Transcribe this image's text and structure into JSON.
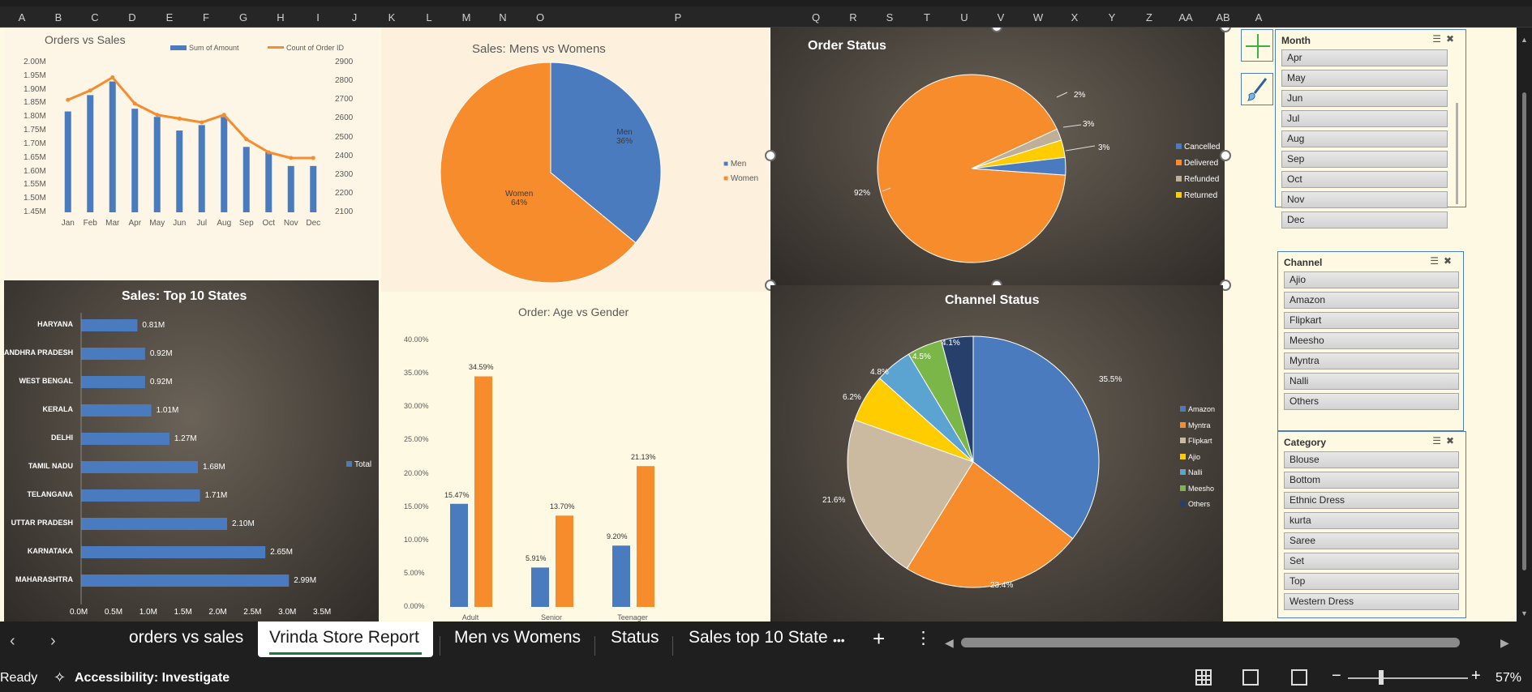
{
  "columns": [
    "A",
    "B",
    "C",
    "D",
    "E",
    "F",
    "G",
    "H",
    "I",
    "J",
    "K",
    "L",
    "M",
    "N",
    "O",
    "P",
    "Q",
    "R",
    "S",
    "T",
    "U",
    "V",
    "W",
    "X",
    "Y",
    "Z",
    "AA",
    "AB",
    "A"
  ],
  "chart_data": [
    {
      "type": "bar",
      "title": "Orders vs Sales",
      "categories": [
        "Jan",
        "Feb",
        "Mar",
        "Apr",
        "May",
        "Jun",
        "Jul",
        "Aug",
        "Sep",
        "Oct",
        "Nov",
        "Dec"
      ],
      "series": [
        {
          "name": "Sum of Amount",
          "type": "bar",
          "values": [
            1.82,
            1.88,
            1.93,
            1.83,
            1.8,
            1.75,
            1.77,
            1.8,
            1.69,
            1.67,
            1.62,
            1.62
          ]
        },
        {
          "name": "Count of Order ID",
          "type": "line",
          "axis": "secondary",
          "values": [
            2700,
            2750,
            2820,
            2680,
            2620,
            2600,
            2580,
            2620,
            2490,
            2420,
            2390,
            2390
          ]
        }
      ],
      "y_ticks": [
        "2.00M",
        "1.95M",
        "1.90M",
        "1.85M",
        "1.80M",
        "1.75M",
        "1.70M",
        "1.65M",
        "1.60M",
        "1.55M",
        "1.50M",
        "1.45M"
      ],
      "y2_ticks": [
        "2900",
        "2800",
        "2700",
        "2600",
        "2500",
        "2400",
        "2300",
        "2200",
        "2100"
      ],
      "ylim": [
        1.45,
        2.0
      ],
      "y2lim": [
        2100,
        2900
      ],
      "legend_position": "top"
    },
    {
      "type": "pie",
      "title": "Sales: Mens vs Womens",
      "slices": [
        {
          "label": "Men",
          "value": 36,
          "color": "#4a7bbf"
        },
        {
          "label": "Women",
          "value": 64,
          "color": "#f78c2d"
        }
      ],
      "labels": {
        "men": "Men",
        "men_pct": "36%",
        "women": "Women",
        "women_pct": "64%"
      },
      "legend_position": "right"
    },
    {
      "type": "pie",
      "title": "Order Status",
      "slices": [
        {
          "label": "Cancelled",
          "value": 3,
          "color": "#4a7bbf"
        },
        {
          "label": "Delivered",
          "value": 92,
          "color": "#f78c2d"
        },
        {
          "label": "Refunded",
          "value": 2,
          "color": "#bfae98"
        },
        {
          "label": "Returned",
          "value": 3,
          "color": "#ffcc00"
        }
      ],
      "pct_labels": [
        "92%",
        "2%",
        "3%",
        "3%"
      ],
      "legend_position": "right"
    },
    {
      "type": "bar",
      "orientation": "horizontal",
      "title": "Sales: Top 10 States",
      "categories": [
        "HARYANA",
        "ANDHRA PRADESH",
        "WEST BENGAL",
        "KERALA",
        "DELHI",
        "TAMIL NADU",
        "TELANGANA",
        "UTTAR PRADESH",
        "KARNATAKA",
        "MAHARASHTRA"
      ],
      "values": [
        0.81,
        0.92,
        0.92,
        1.01,
        1.27,
        1.68,
        1.71,
        2.1,
        2.65,
        2.99
      ],
      "value_labels": [
        "0.81M",
        "0.92M",
        "0.92M",
        "1.01M",
        "1.27M",
        "1.68M",
        "1.71M",
        "2.10M",
        "2.65M",
        "2.99M"
      ],
      "x_ticks": [
        "0.0M",
        "0.5M",
        "1.0M",
        "1.5M",
        "2.0M",
        "2.5M",
        "3.0M",
        "3.5M"
      ],
      "xlim": [
        0,
        3.5
      ],
      "series_name": "Total",
      "legend_position": "right"
    },
    {
      "type": "bar",
      "title": "Order: Age vs Gender",
      "categories": [
        "Adult",
        "Senior",
        "Teenager"
      ],
      "series": [
        {
          "values": [
            15.47,
            5.91,
            9.2
          ],
          "labels": [
            "15.47%",
            "5.91%",
            "9.20%"
          ]
        },
        {
          "values": [
            34.59,
            13.7,
            21.13
          ],
          "labels": [
            "34.59%",
            "13.70%",
            "21.13%"
          ]
        }
      ],
      "y_ticks": [
        "40.00%",
        "35.00%",
        "30.00%",
        "25.00%",
        "20.00%",
        "15.00%",
        "10.00%",
        "5.00%",
        "0.00%"
      ],
      "ylim": [
        0,
        40
      ]
    },
    {
      "type": "pie",
      "title": "Channel Status",
      "slices": [
        {
          "label": "Amazon",
          "value": 35.5,
          "pct": "35.5%",
          "color": "#4a7bbf"
        },
        {
          "label": "Myntra",
          "value": 23.4,
          "pct": "23.4%",
          "color": "#f78c2d"
        },
        {
          "label": "Flipkart",
          "value": 21.6,
          "pct": "21.6%",
          "color": "#cbb9a0"
        },
        {
          "label": "Ajio",
          "value": 6.2,
          "pct": "6.2%",
          "color": "#ffcc00"
        },
        {
          "label": "Nalli",
          "value": 4.8,
          "pct": "4.8%",
          "color": "#5ba3d0"
        },
        {
          "label": "Meesho",
          "value": 4.5,
          "pct": "4.5%",
          "color": "#7ab648"
        },
        {
          "label": "Others",
          "value": 4.1,
          "pct": "4.1%",
          "color": "#26406b"
        }
      ],
      "legend_position": "right"
    }
  ],
  "slicers": {
    "month": {
      "title": "Month",
      "items": [
        "Apr",
        "May",
        "Jun",
        "Jul",
        "Aug",
        "Sep",
        "Oct",
        "Nov",
        "Dec"
      ]
    },
    "channel": {
      "title": "Channel",
      "items": [
        "Ajio",
        "Amazon",
        "Flipkart",
        "Meesho",
        "Myntra",
        "Nalli",
        "Others"
      ]
    },
    "category": {
      "title": "Category",
      "items": [
        "Blouse",
        "Bottom",
        "Ethnic Dress",
        "kurta",
        "Saree",
        "Set",
        "Top",
        "Western Dress"
      ]
    }
  },
  "tabs": {
    "items": [
      "orders vs sales",
      "Vrinda Store Report",
      "Men vs Womens",
      "Status",
      "Sales top 10 State"
    ],
    "active_index": 1,
    "more": "•••",
    "add": "+",
    "menu": "⋮"
  },
  "status": {
    "ready": "Ready",
    "accessibility": "Accessibility: Investigate",
    "zoom": "57%"
  },
  "colors": {
    "accent_blue": "#4a7bbf",
    "accent_orange": "#f78c2d",
    "tab_underline": "#1e7a3c"
  }
}
